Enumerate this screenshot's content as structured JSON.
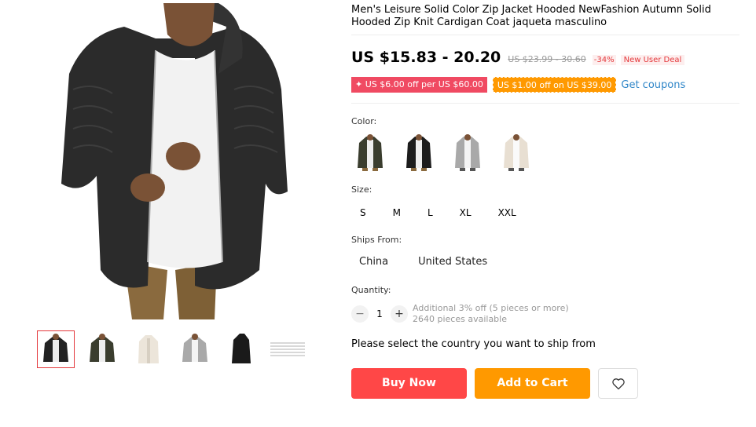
{
  "product": {
    "title": "Men's Leisure Solid Color Zip Jacket Hooded NewFashion Autumn Solid Hooded Zip Knit Cardigan Coat jaqueta masculino",
    "price": "US $15.83 - 20.20",
    "original_price": "US $23.99 - 30.60",
    "discount": "-34%",
    "new_user_badge": "New User Deal"
  },
  "coupons": {
    "pink": "✦ US $6.00 off per US $60.00",
    "orange": "US $1.00 off on US $39.00",
    "get_coupons": "Get coupons"
  },
  "color": {
    "label": "Color:",
    "swatches": [
      {
        "name": "dark-green",
        "color": "#3a3d2e"
      },
      {
        "name": "black",
        "color": "#1c1c1c"
      },
      {
        "name": "light-gray",
        "color": "#a9a9a9"
      },
      {
        "name": "beige",
        "color": "#e8dfd2"
      }
    ]
  },
  "size": {
    "label": "Size:",
    "options": [
      "S",
      "M",
      "L",
      "XL",
      "XXL"
    ]
  },
  "ships_from": {
    "label": "Ships From:",
    "options": [
      "China",
      "United States"
    ]
  },
  "quantity": {
    "label": "Quantity:",
    "value": "1",
    "minus": "−",
    "plus": "+",
    "additional": "Additional 3% off (5 pieces or more)",
    "available": "2640 pieces available"
  },
  "ship_note": "Please select the country you want to ship from",
  "actions": {
    "buy_now": "Buy Now",
    "add_to_cart": "Add to Cart"
  },
  "colors": {
    "accent_red": "#ff4747",
    "accent_orange": "#ff9900",
    "link_blue": "#2f86c8"
  }
}
